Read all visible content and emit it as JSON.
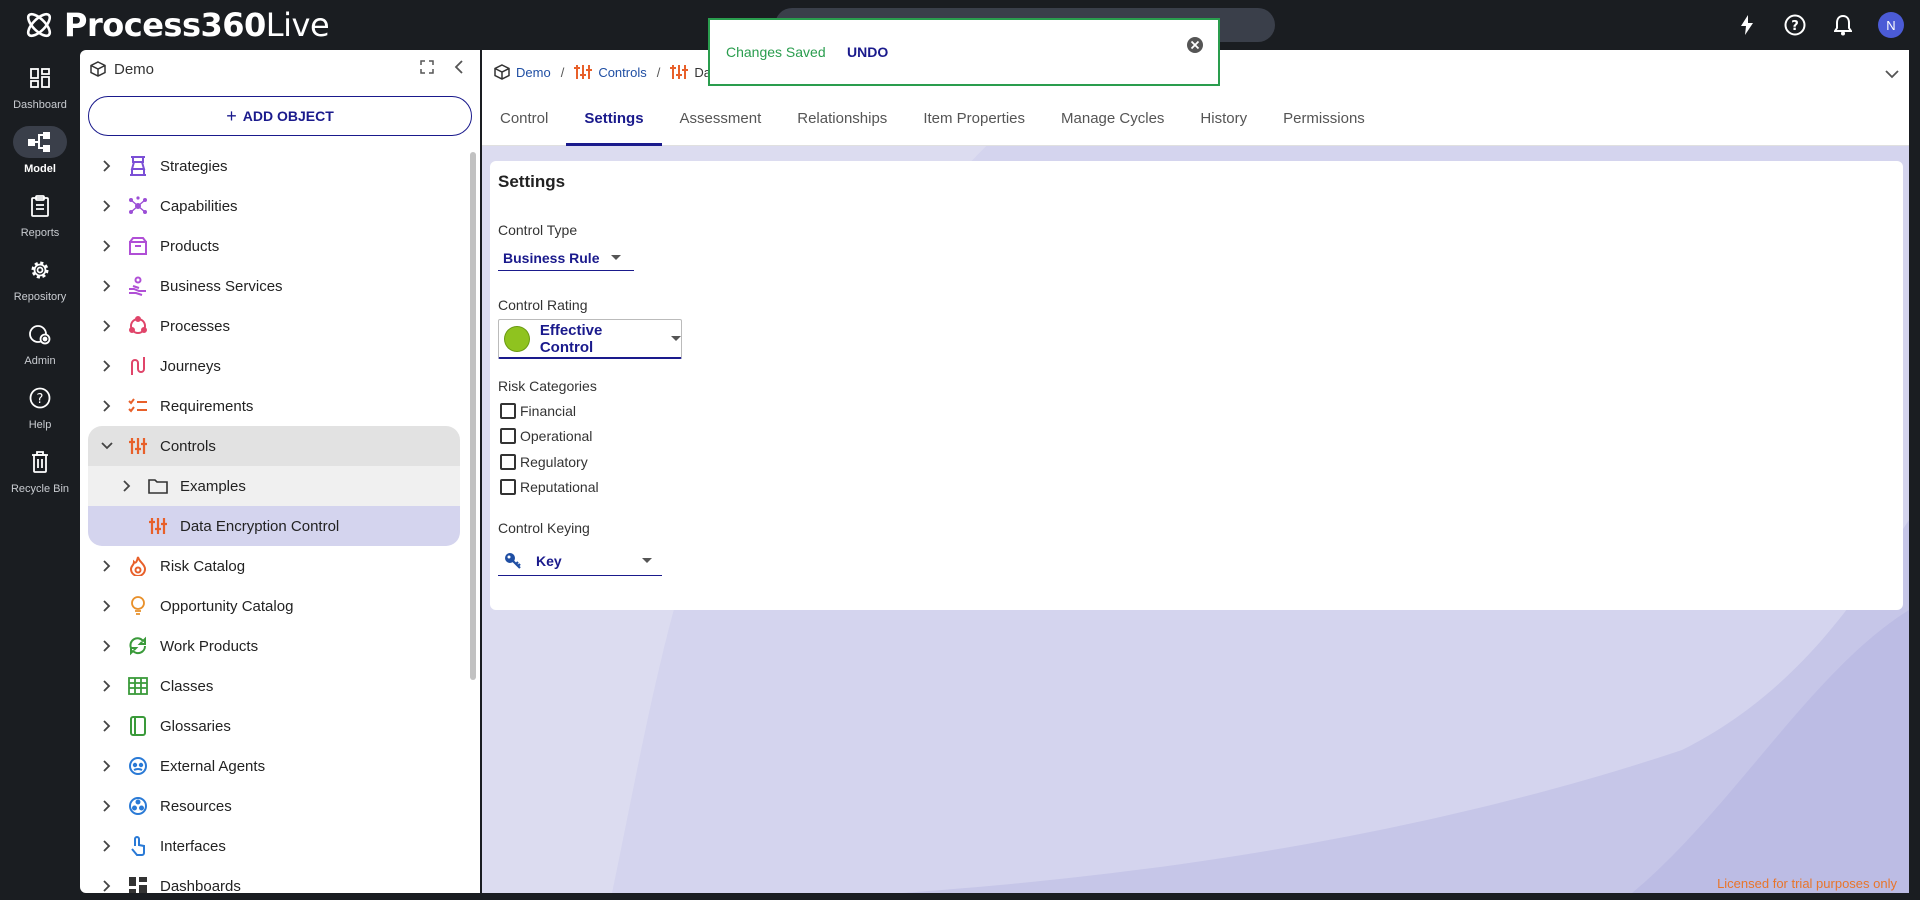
{
  "app": {
    "brand_bold": "Process360",
    "brand_light": "Live",
    "avatar_initial": "N"
  },
  "rail": [
    {
      "label": "Dashboard",
      "icon": "dashboard-icon"
    },
    {
      "label": "Model",
      "icon": "model-icon",
      "active": true
    },
    {
      "label": "Reports",
      "icon": "reports-icon"
    },
    {
      "label": "Repository",
      "icon": "gear-icon"
    },
    {
      "label": "Admin",
      "icon": "admin-icon"
    },
    {
      "label": "Help",
      "icon": "help-icon"
    },
    {
      "label": "Recycle Bin",
      "icon": "trash-icon"
    }
  ],
  "panel": {
    "title": "Demo",
    "add_button": "ADD OBJECT",
    "tree": [
      {
        "label": "Strategies",
        "icon": "strategies-icon",
        "color": "#7b4fd6"
      },
      {
        "label": "Capabilities",
        "icon": "capabilities-icon",
        "color": "#9c4fd6"
      },
      {
        "label": "Products",
        "icon": "products-icon",
        "color": "#b04fd6"
      },
      {
        "label": "Business Services",
        "icon": "business-services-icon",
        "color": "#b04fd6"
      },
      {
        "label": "Processes",
        "icon": "processes-icon",
        "color": "#e0456a"
      },
      {
        "label": "Journeys",
        "icon": "journeys-icon",
        "color": "#e0456a"
      },
      {
        "label": "Requirements",
        "icon": "requirements-icon",
        "color": "#e8602a"
      },
      {
        "label": "Controls",
        "icon": "controls-icon",
        "color": "#e8602a",
        "expanded": true
      },
      {
        "label": "Examples",
        "icon": "folder-icon",
        "color": "#333333",
        "child": true
      },
      {
        "label": "Data Encryption Control",
        "icon": "controls-icon",
        "color": "#e8602a",
        "child": true,
        "selected": true
      },
      {
        "label": "Risk Catalog",
        "icon": "risk-icon",
        "color": "#e8602a"
      },
      {
        "label": "Opportunity Catalog",
        "icon": "lightbulb-icon",
        "color": "#e8902a"
      },
      {
        "label": "Work Products",
        "icon": "work-products-icon",
        "color": "#3a9a3a"
      },
      {
        "label": "Classes",
        "icon": "classes-icon",
        "color": "#3a9a3a"
      },
      {
        "label": "Glossaries",
        "icon": "glossaries-icon",
        "color": "#3a9a3a"
      },
      {
        "label": "External Agents",
        "icon": "external-agents-icon",
        "color": "#2a7ad6"
      },
      {
        "label": "Resources",
        "icon": "resources-icon",
        "color": "#2a7ad6"
      },
      {
        "label": "Interfaces",
        "icon": "interfaces-icon",
        "color": "#2a7ad6"
      },
      {
        "label": "Dashboards",
        "icon": "dashboards-icon",
        "color": "#333333"
      }
    ]
  },
  "breadcrumb": {
    "root": "Demo",
    "parent": "Controls",
    "current": "Da"
  },
  "tabs": [
    "Control",
    "Settings",
    "Assessment",
    "Relationships",
    "Item Properties",
    "Manage Cycles",
    "History",
    "Permissions"
  ],
  "active_tab": "Settings",
  "settings": {
    "heading": "Settings",
    "control_type_label": "Control Type",
    "control_type_value": "Business Rule",
    "control_rating_label": "Control Rating",
    "control_rating_value": "Effective Control",
    "control_rating_color": "#8fc31f",
    "risk_categories_label": "Risk Categories",
    "risk_categories": [
      {
        "label": "Financial",
        "checked": false
      },
      {
        "label": "Operational",
        "checked": false
      },
      {
        "label": "Regulatory",
        "checked": false
      },
      {
        "label": "Reputational",
        "checked": false
      }
    ],
    "control_keying_label": "Control Keying",
    "control_keying_value": "Key"
  },
  "toast": {
    "message": "Changes Saved",
    "action": "UNDO"
  },
  "footer": {
    "license": "Licensed for trial purposes only"
  },
  "colors": {
    "accent": "#1a1a8c",
    "success": "#2a9d4e",
    "warning": "#e8752a"
  }
}
